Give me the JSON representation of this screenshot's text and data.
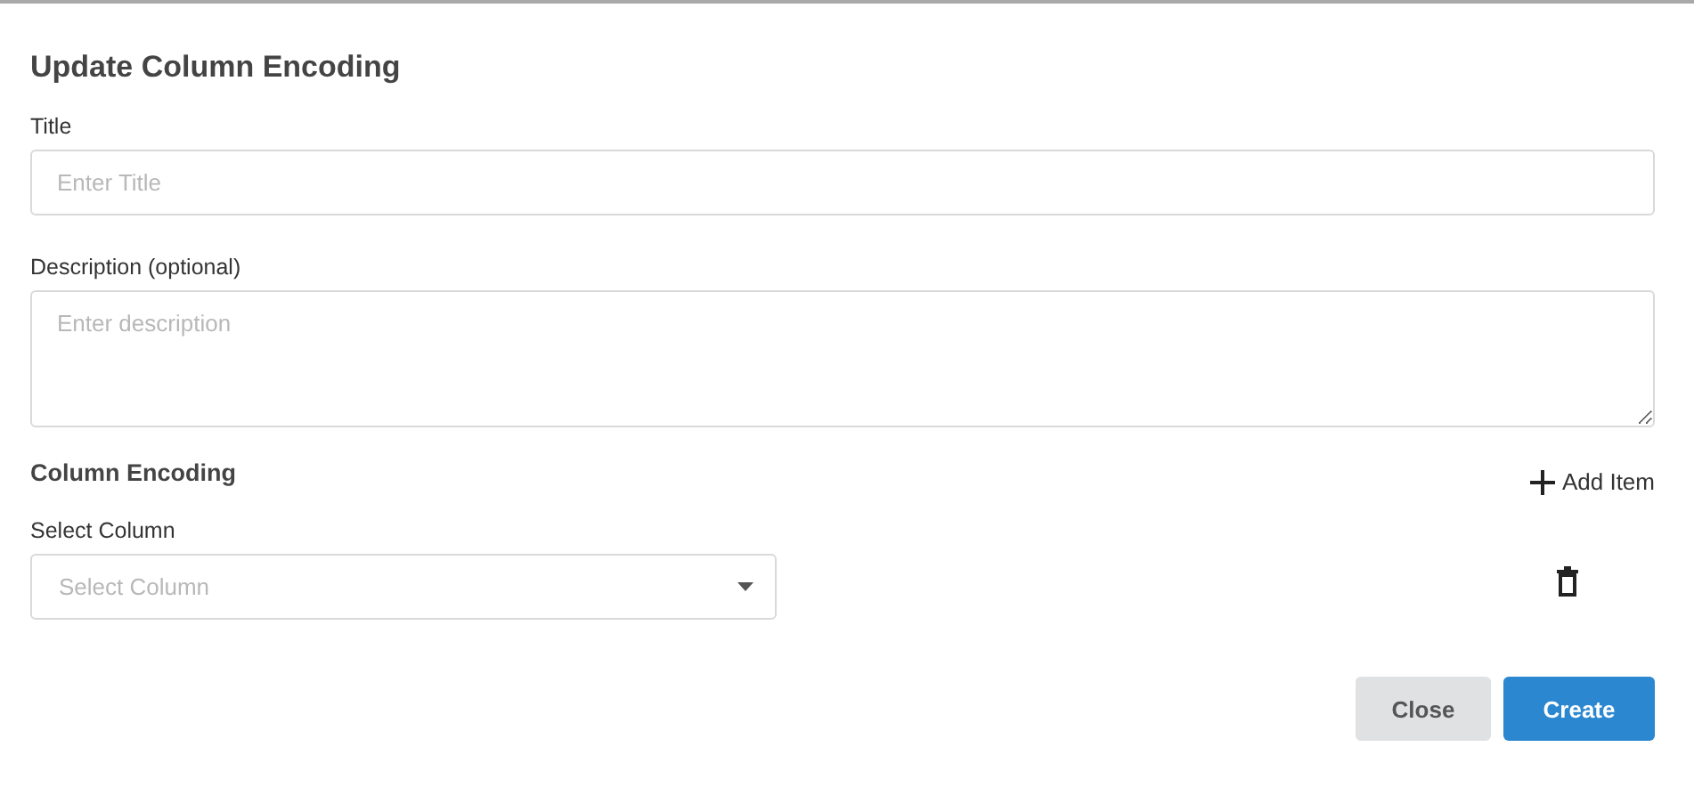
{
  "dialog": {
    "title": "Update Column Encoding"
  },
  "fields": [
    {
      "label": "Title",
      "placeholder": "Enter Title",
      "kind": "input"
    },
    {
      "label": "Description (optional)",
      "placeholder": "Enter description",
      "kind": "textarea"
    }
  ],
  "column_encoding": {
    "heading": "Column Encoding",
    "add_button": "Add Item",
    "items": [
      {
        "label": "Select Column",
        "placeholder": "Select Column"
      }
    ]
  },
  "buttons": [
    {
      "label": "Close",
      "kind": "secondary"
    },
    {
      "label": "Create",
      "kind": "primary"
    }
  ]
}
